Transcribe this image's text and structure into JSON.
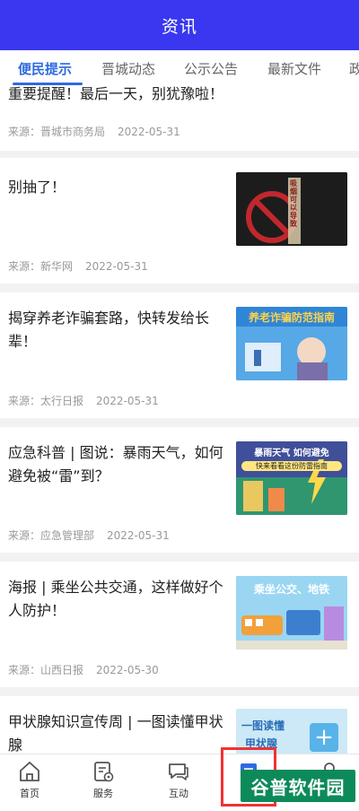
{
  "header": {
    "title": "资讯"
  },
  "tabs": [
    {
      "label": "便民提示",
      "active": true
    },
    {
      "label": "晋城动态",
      "active": false
    },
    {
      "label": "公示公告",
      "active": false
    },
    {
      "label": "最新文件",
      "active": false
    },
    {
      "label": "政",
      "active": false
    }
  ],
  "articles": [
    {
      "title": "重要提醒！最后一天，别犹豫啦！",
      "source": "来源：晋城市商务局",
      "date": "2022-05-31"
    },
    {
      "title": "别抽了！",
      "source": "来源：新华网",
      "date": "2022-05-31"
    },
    {
      "title": "揭穿养老诈骗套路，快转发给长辈！",
      "source": "来源：太行日报",
      "date": "2022-05-31"
    },
    {
      "title": "应急科普 | 图说：暴雨天气，如何避免被“雷”到？",
      "source": "来源：应急管理部",
      "date": "2022-05-31"
    },
    {
      "title": "海报 | 乘坐公共交通，这样做好个人防护！",
      "source": "来源：山西日报",
      "date": "2022-05-30"
    },
    {
      "title": "甲状腺知识宣传周 | 一图读懂甲状腺",
      "source": "",
      "date": ""
    }
  ],
  "thumbnails": {
    "smoking": "吸烟可以导致",
    "elderly": "养老诈骗防范指南",
    "storm": {
      "line1": "暴雨天气 如何避免",
      "line2": "快来看看这份防雷指南"
    },
    "transit": "乘坐公交、地铁",
    "thyroid": {
      "line1": "一图读懂",
      "line2": "甲状腺"
    }
  },
  "tabbar": [
    {
      "label": "首页",
      "icon": "home-icon"
    },
    {
      "label": "服务",
      "icon": "service-icon"
    },
    {
      "label": "互动",
      "icon": "chat-icon"
    },
    {
      "label": "",
      "icon": "news-icon"
    },
    {
      "label": "",
      "icon": "user-icon"
    }
  ],
  "watermark": "谷普软件园",
  "colors": {
    "header": "#3a37f0",
    "accent": "#2d6be0",
    "highlight": "#e33333",
    "watermark": "#0d8a5a"
  }
}
